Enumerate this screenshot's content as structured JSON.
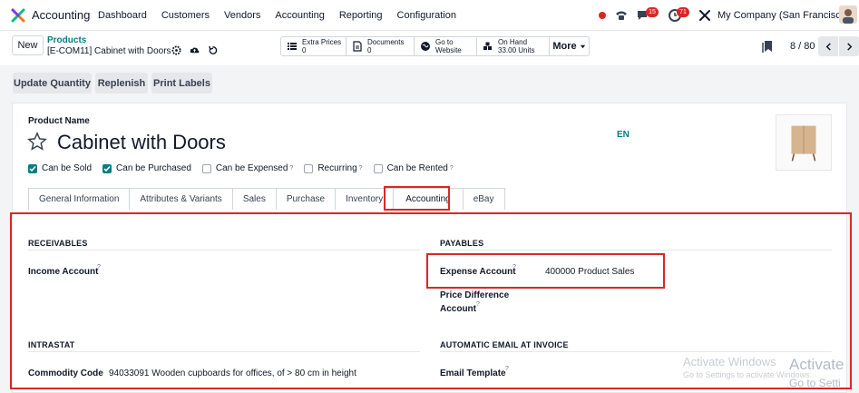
{
  "navbar": {
    "app_name": "Accounting",
    "menu": [
      "Dashboard",
      "Customers",
      "Vendors",
      "Accounting",
      "Reporting",
      "Configuration"
    ],
    "chat_badge": "15",
    "activity_badge": "71",
    "company": "My Company (San Francisco)"
  },
  "control": {
    "new_label": "New",
    "breadcrumb_parent": "Products",
    "breadcrumb_current": "[E-COM11] Cabinet with Doors",
    "smart_buttons": [
      {
        "label": "Extra Prices",
        "value": "0"
      },
      {
        "label": "Documents",
        "value": "0"
      },
      {
        "label": "Go to",
        "value": "Website"
      },
      {
        "label": "On Hand",
        "value": "33.00 Units"
      }
    ],
    "more_label": "More",
    "pager": "8 / 80"
  },
  "actions": [
    "Update Quantity",
    "Replenish",
    "Print Labels"
  ],
  "form": {
    "product_name_label": "Product Name",
    "product_name": "Cabinet with Doors",
    "lang": "EN",
    "checkboxes": [
      {
        "label": "Can be Sold",
        "checked": true,
        "help": ""
      },
      {
        "label": "Can be Purchased",
        "checked": true,
        "help": ""
      },
      {
        "label": "Can be Expensed",
        "checked": false,
        "help": "?"
      },
      {
        "label": "Recurring",
        "checked": false,
        "help": "?"
      },
      {
        "label": "Can be Rented",
        "checked": false,
        "help": "?"
      }
    ],
    "tabs": [
      "General Information",
      "Attributes & Variants",
      "Sales",
      "Purchase",
      "Inventory",
      "Accounting",
      "eBay"
    ],
    "active_tab": "Accounting"
  },
  "accounting": {
    "receivables_title": "RECEIVABLES",
    "income_label": "Income Account",
    "payables_title": "PAYABLES",
    "expense_label": "Expense Account",
    "expense_value": "400000 Product Sales",
    "price_diff_label_1": "Price Difference",
    "price_diff_label_2": "Account",
    "intrastat_title": "INTRASTAT",
    "commodity_label": "Commodity Code",
    "commodity_value": "94033091 Wooden cupboards for offices, of > 80 cm in height",
    "auto_email_title": "AUTOMATIC EMAIL AT INVOICE",
    "email_template_label": "Email Template",
    "help_mark": "?"
  },
  "overlay": {
    "wm_back_line1": "Activate Windows",
    "wm_back_line2": "Go to Settings to activate Windows.",
    "wm_front_line1": "Activate",
    "wm_front_line2": "Go to Setti"
  },
  "colors": {
    "accent": "#017e84",
    "highlight": "#dc2626"
  }
}
